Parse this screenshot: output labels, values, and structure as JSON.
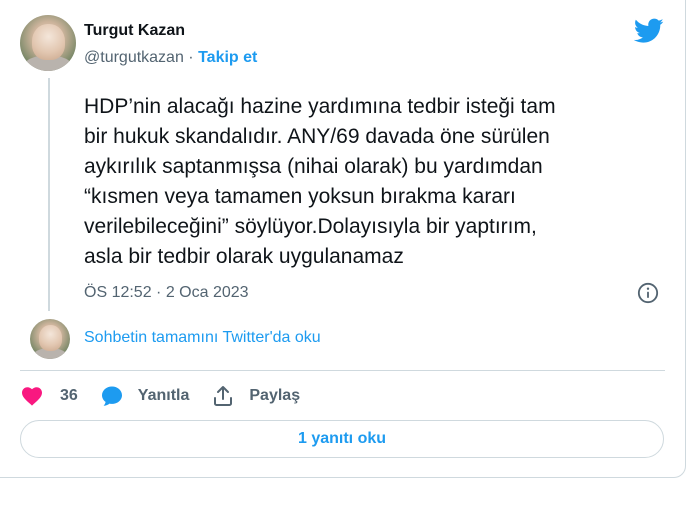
{
  "author": {
    "name": "Turgut Kazan",
    "handle": "@turgutkazan",
    "separator": " · ",
    "follow_label": "Takip et"
  },
  "tweet": {
    "text": "HDP’nin alacağı hazine yardımına tedbir isteği tam\nbir hukuk skandalıdır. ANY/69 davada öne sürülen\naykırılık saptanmışsa (nihai olarak) bu yardımdan\n“kısmen veya tamamen yoksun bırakma kararı\nverilebileceğini” söylüyor.Dolayısıyla bir yaptırım,\nasla bir tedbir olarak uygulanamaz",
    "timestamp": "ÖS 12:52 · 2 Oca 2023"
  },
  "thread": {
    "read_label": "Sohbetin tamamını Twitter'da oku"
  },
  "actions": {
    "like_count": "36",
    "reply_label": "Yanıtla",
    "share_label": "Paylaş"
  },
  "replies": {
    "button_label": "1 yanıtı oku"
  },
  "icons": {
    "brand": "twitter-bird-icon",
    "info": "info-icon",
    "like": "heart-icon",
    "reply": "speech-bubble-icon",
    "share": "share-icon"
  },
  "colors": {
    "accent": "#1d9bf0",
    "like": "#f91880",
    "text": "#0f1419",
    "secondary": "#536471",
    "border": "#cfd9de"
  }
}
